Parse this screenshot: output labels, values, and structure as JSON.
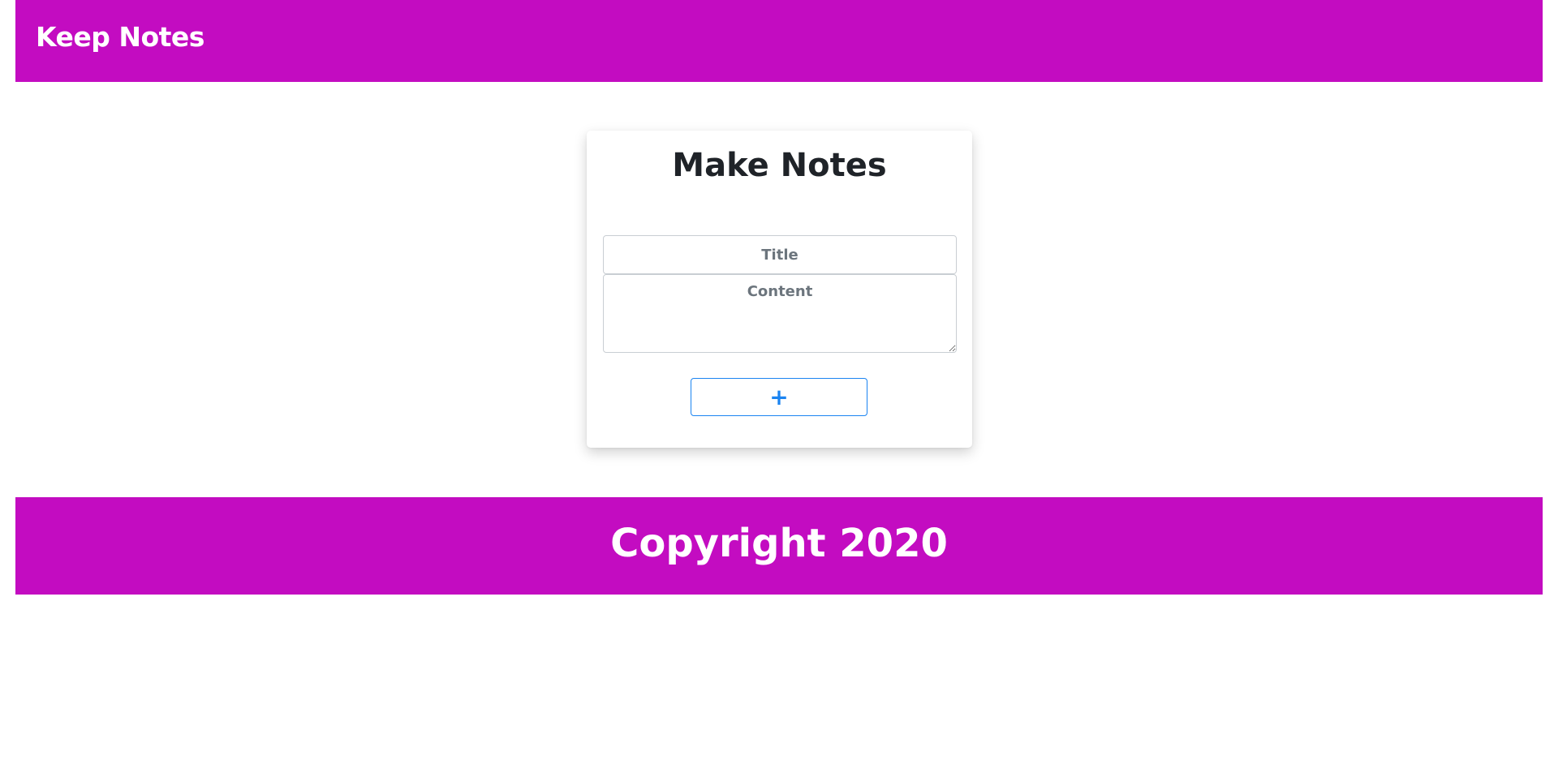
{
  "header": {
    "brand": "Keep Notes"
  },
  "form": {
    "heading": "Make Notes",
    "title_placeholder": "Title",
    "content_placeholder": "Content",
    "add_label": "+"
  },
  "footer": {
    "text": "Copyright 2020"
  },
  "colors": {
    "header_bg": "#c30cc1",
    "footer_bg": "#c30cc1",
    "button_accent": "#1b84f1",
    "heading_text": "#1f2328",
    "placeholder_text": "#6c757d"
  }
}
